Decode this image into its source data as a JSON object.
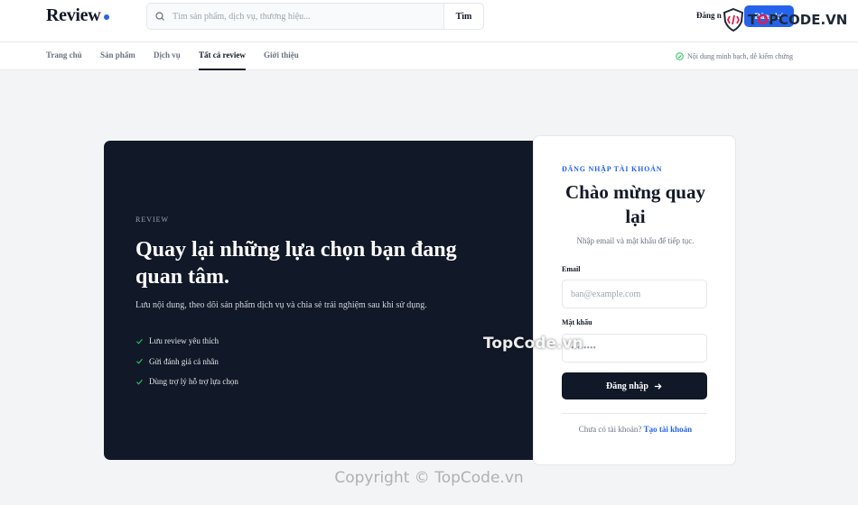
{
  "header": {
    "logo": "Review",
    "search_placeholder": "Tìm sản phẩm, dịch vụ, thương hiệu...",
    "search_button": "Tìm",
    "login_link": "Đăng n",
    "signup_button": "Đăng ký"
  },
  "watermark": {
    "badge_prefix": "T",
    "badge_highlight": "O",
    "badge_suffix": "PCODE.VN",
    "overlay": "TopCode.vn",
    "copyright": "Copyright © TopCode.vn"
  },
  "nav": {
    "items": [
      {
        "label": "Trang chủ"
      },
      {
        "label": "Sản phẩm"
      },
      {
        "label": "Dịch vụ"
      },
      {
        "label": "Tất cả review"
      },
      {
        "label": "Giới thiệu"
      }
    ],
    "active_index": 3,
    "trust_text": "Nội dung minh bạch, dễ kiểm chứng"
  },
  "hero": {
    "eyebrow": "REVIEW",
    "title": "Quay lại những lựa chọn bạn đang quan tâm.",
    "description": "Lưu nội dung, theo dõi sản phẩm dịch vụ và chia sẻ trải nghiệm sau khi sử dụng.",
    "benefits": [
      "Lưu review yêu thích",
      "Gửi đánh giá cá nhân",
      "Dùng trợ lý hỗ trợ lựa chọn"
    ]
  },
  "login_form": {
    "eyebrow": "ĐĂNG NHẬP TÀI KHOẢN",
    "title": "Chào mừng quay lại",
    "subtitle": "Nhập email và mật khẩu để tiếp tục.",
    "email_label": "Email",
    "email_placeholder": "ban@example.com",
    "password_label": "Mật khẩu",
    "password_placeholder": "••••••••",
    "submit_label": "Đăng nhập",
    "footer_text": "Chưa có tài khoản?",
    "footer_link": "Tạo tài khoản"
  },
  "colors": {
    "accent": "#2563eb",
    "dark": "#111827",
    "check": "#22c55e"
  }
}
